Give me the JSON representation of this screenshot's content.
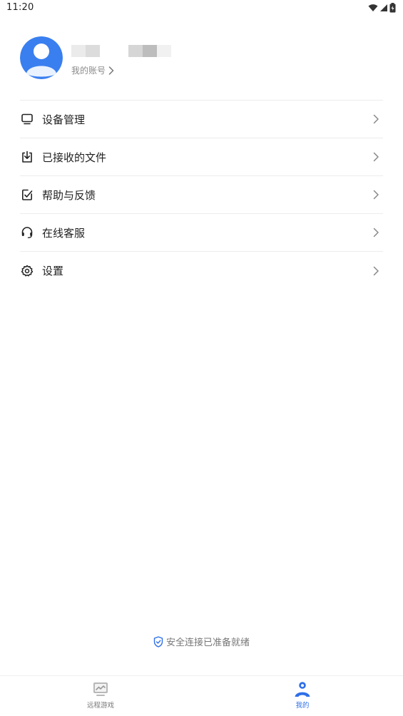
{
  "status_bar": {
    "time": "11:20"
  },
  "profile": {
    "account_label": "我的账号"
  },
  "menu": {
    "items": [
      {
        "label": "设备管理",
        "icon": "monitor-icon"
      },
      {
        "label": "已接收的文件",
        "icon": "download-icon"
      },
      {
        "label": "帮助与反馈",
        "icon": "feedback-icon"
      },
      {
        "label": "在线客服",
        "icon": "headset-icon"
      },
      {
        "label": "设置",
        "icon": "gear-icon"
      }
    ]
  },
  "footer": {
    "secure_text": "安全连接已准备就绪"
  },
  "bottom_nav": {
    "tabs": [
      {
        "label": "远程游戏",
        "icon": "remote-game-icon",
        "active": false
      },
      {
        "label": "我的",
        "icon": "profile-icon",
        "active": true
      }
    ]
  },
  "colors": {
    "accent": "#2f6fe8",
    "avatar_bg": "#3a7ff0",
    "divider": "#ececec",
    "muted_text": "#8a8a8a"
  }
}
